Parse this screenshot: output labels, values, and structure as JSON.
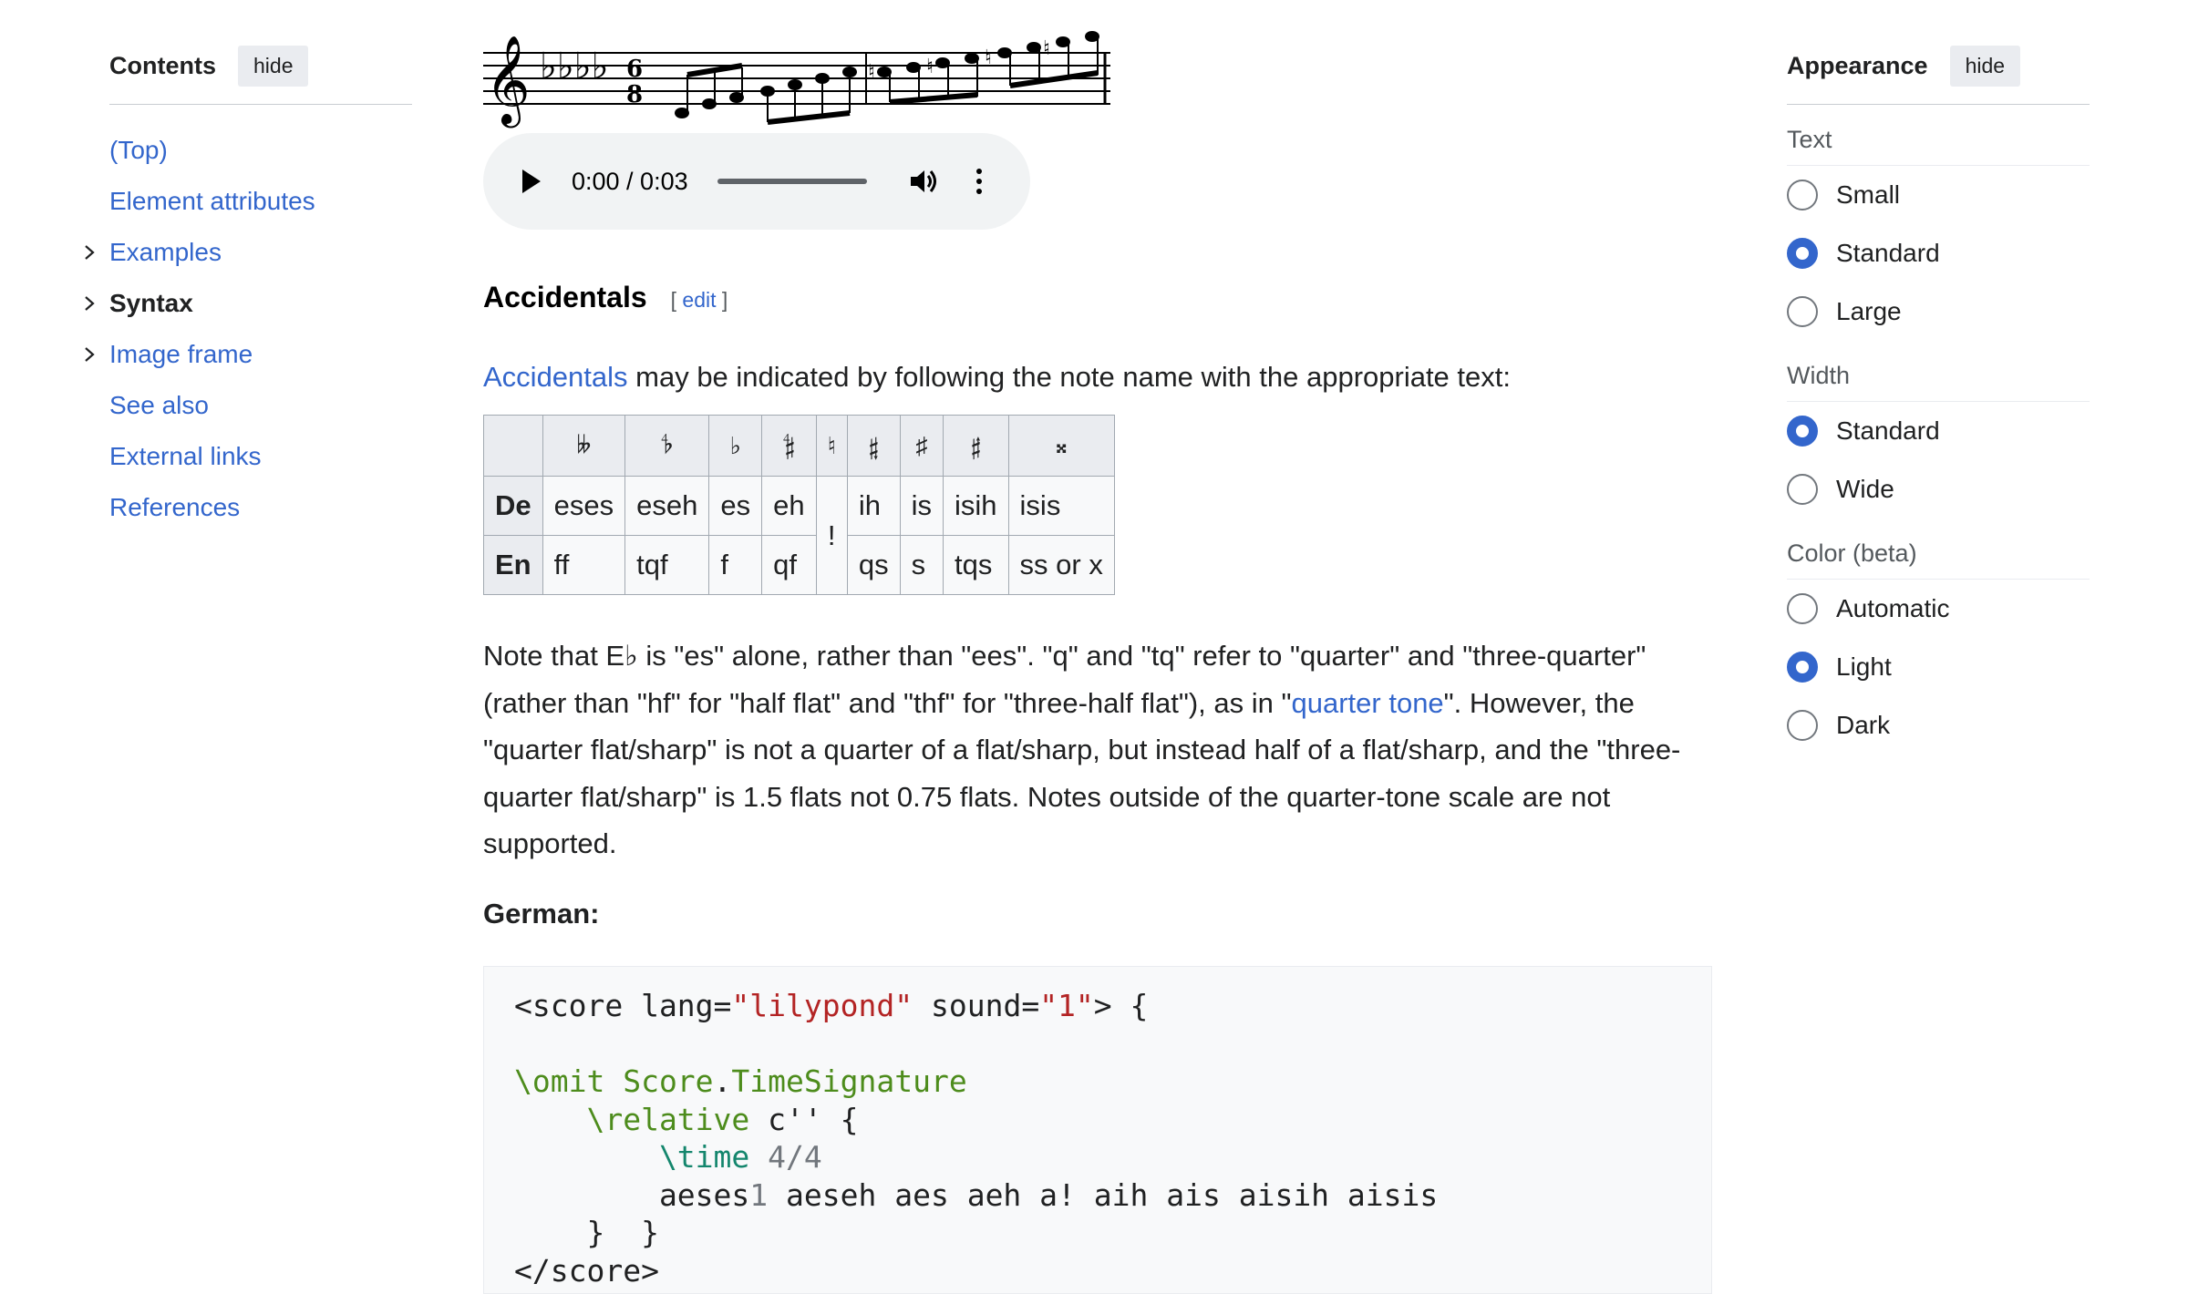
{
  "toc": {
    "title": "Contents",
    "hide_label": "hide",
    "items": [
      {
        "label": "(Top)",
        "chevron": false,
        "current": false
      },
      {
        "label": "Element attributes",
        "chevron": false,
        "current": false
      },
      {
        "label": "Examples",
        "chevron": true,
        "current": false
      },
      {
        "label": "Syntax",
        "chevron": true,
        "current": true
      },
      {
        "label": "Image frame",
        "chevron": true,
        "current": false
      },
      {
        "label": "See also",
        "chevron": false,
        "current": false
      },
      {
        "label": "External links",
        "chevron": false,
        "current": false
      },
      {
        "label": "References",
        "chevron": false,
        "current": false
      }
    ]
  },
  "audio": {
    "time": "0:00 / 0:03",
    "progress": 0
  },
  "section": {
    "heading": "Accidentals",
    "edit_open": "[ ",
    "edit_label": "edit",
    "edit_close": " ]",
    "intro_link": "Accidentals",
    "intro_rest": " may be indicated by following the note name with the appropriate text:"
  },
  "accidentals_table": {
    "symbols": [
      "𝄫",
      "𝄳",
      "♭",
      "𝄲",
      "♮",
      "𝄱",
      "♯",
      "𝄰",
      "𝄪"
    ],
    "rows": [
      {
        "label": "De",
        "cells": [
          "eses",
          "eseh",
          "es",
          "eh",
          "ih",
          "is",
          "isih",
          "isis"
        ]
      },
      {
        "label": "En",
        "cells": [
          "ff",
          "tqf",
          "f",
          "qf",
          "qs",
          "s",
          "tqs",
          "ss or x"
        ]
      }
    ],
    "natural": "!"
  },
  "note": {
    "part1": "Note that E♭ is \"es\" alone, rather than \"ees\". \"q\" and \"tq\" refer to \"quarter\" and \"three-quarter\" (rather than \"hf\" for \"half flat\" and \"thf\" for \"three-half flat\"), as in \"",
    "link": "quarter tone",
    "part2": "\". However, the \"quarter flat/sharp\" is not a quarter of a flat/sharp, but instead half of a flat/sharp, and the \"three-quarter flat/sharp\" is 1.5 flats not 0.75 flats. Notes outside of the quarter-tone scale are not supported."
  },
  "german_heading": "German:",
  "code": {
    "l1a": "<score lang=",
    "l1b": "\"lilypond\"",
    "l1c": " sound=",
    "l1d": "\"1\"",
    "l1e": "> {",
    "l3a": "\\omit Score",
    "l3b": ".",
    "l3c": "TimeSignature",
    "l4a": "    \\relative",
    "l4b": " c'' {",
    "l5a": "        \\time",
    "l5b": " 4/4",
    "l6a": "        aeses",
    "l6b": "1",
    "l6c": " aeseh aes aeh a! aih ais aisih aisis",
    "l7": "    }  }",
    "l8": "</score>"
  },
  "appearance": {
    "title": "Appearance",
    "hide_label": "hide",
    "groups": [
      {
        "title": "Text",
        "options": [
          {
            "label": "Small",
            "checked": false
          },
          {
            "label": "Standard",
            "checked": true
          },
          {
            "label": "Large",
            "checked": false
          }
        ]
      },
      {
        "title": "Width",
        "options": [
          {
            "label": "Standard",
            "checked": true
          },
          {
            "label": "Wide",
            "checked": false
          }
        ]
      },
      {
        "title": "Color (beta)",
        "options": [
          {
            "label": "Automatic",
            "checked": false
          },
          {
            "label": "Light",
            "checked": true
          },
          {
            "label": "Dark",
            "checked": false
          }
        ]
      }
    ]
  },
  "colors": {
    "link": "#3366cc",
    "radio_on": "#3366cc",
    "code_bg": "#f8f9fa"
  }
}
